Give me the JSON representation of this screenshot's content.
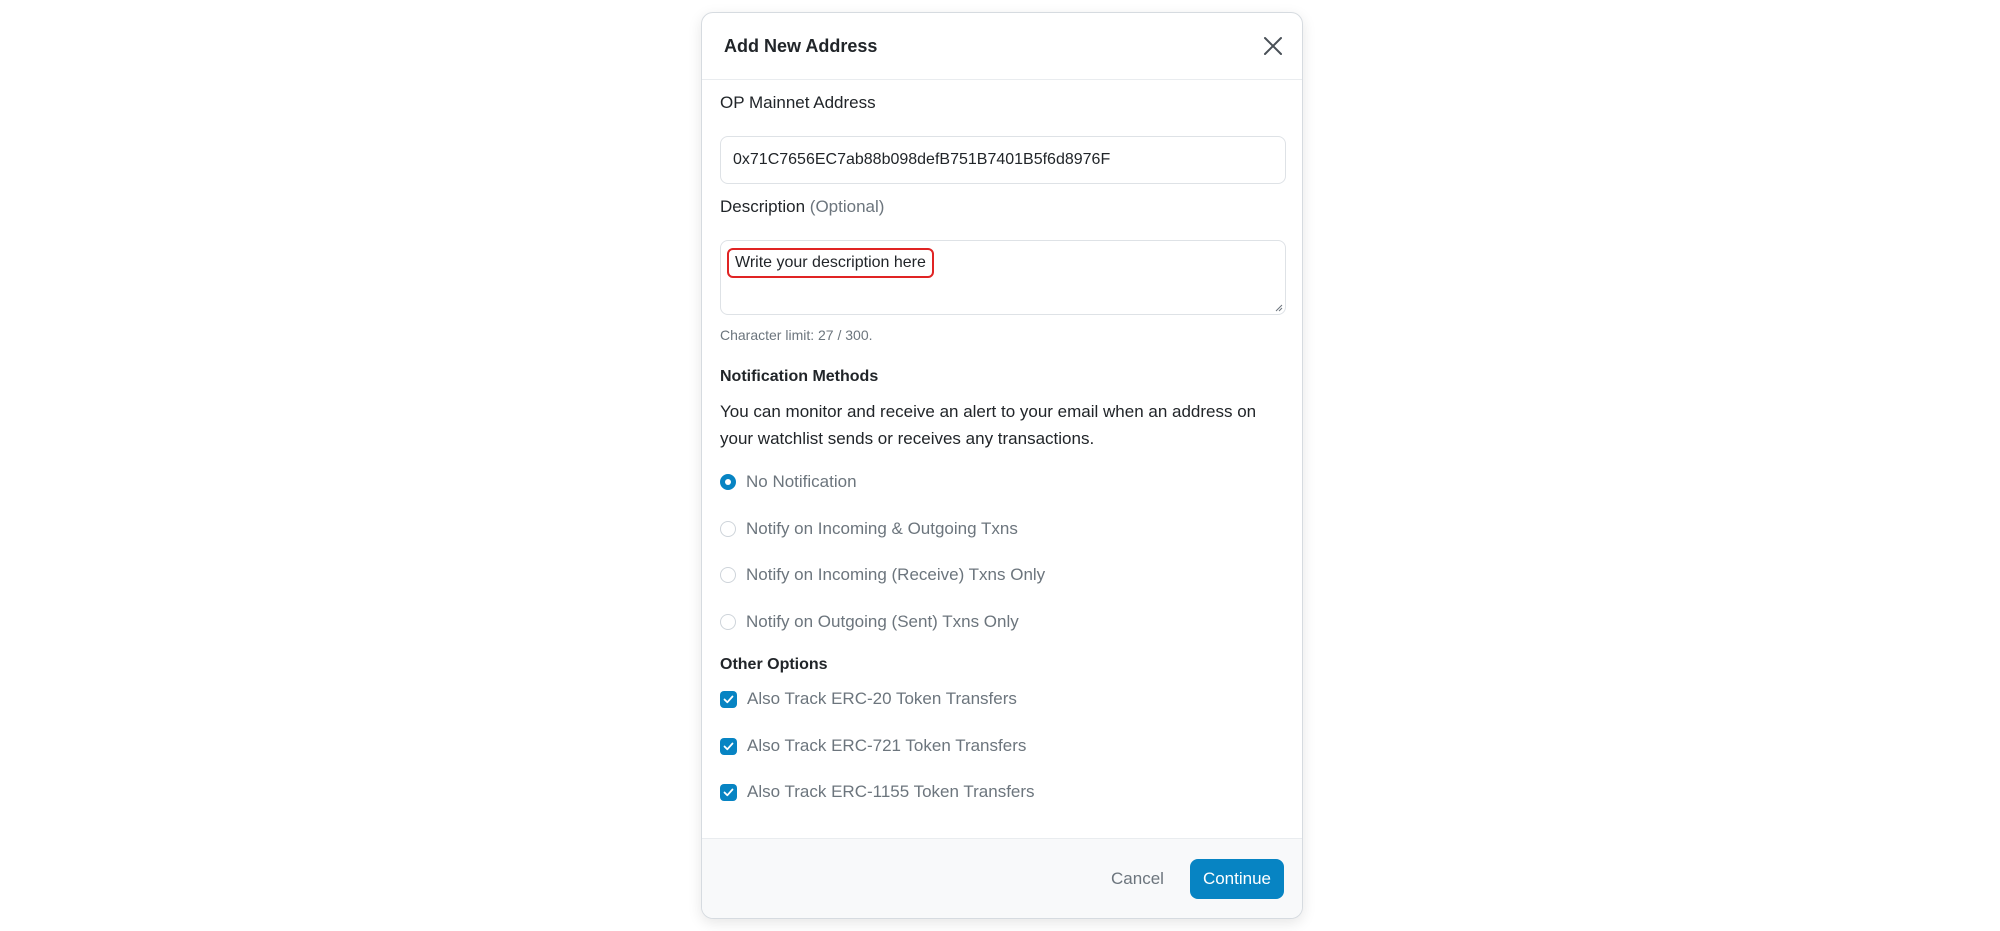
{
  "modal": {
    "title": "Add New Address"
  },
  "address_field": {
    "label": "OP Mainnet Address",
    "value": "0x71C7656EC7ab88b098defB751B7401B5f6d8976F"
  },
  "description_field": {
    "label": "Description",
    "optional_label": "(Optional)",
    "placeholder": "Write your description here",
    "char_limit_text": "Character limit: 27 / 300."
  },
  "notification": {
    "title": "Notification Methods",
    "description": "You can monitor and receive an alert to your email when an address on your watchlist sends or receives any transactions.",
    "options": [
      {
        "label": "No Notification",
        "selected": true
      },
      {
        "label": "Notify on Incoming & Outgoing Txns",
        "selected": false
      },
      {
        "label": "Notify on Incoming (Receive) Txns Only",
        "selected": false
      },
      {
        "label": "Notify on Outgoing (Sent) Txns Only",
        "selected": false
      }
    ]
  },
  "other_options": {
    "title": "Other Options",
    "options": [
      {
        "label": "Also Track ERC-20 Token Transfers",
        "checked": true
      },
      {
        "label": "Also Track ERC-721 Token Transfers",
        "checked": true
      },
      {
        "label": "Also Track ERC-1155 Token Transfers",
        "checked": true
      }
    ]
  },
  "footer": {
    "cancel_label": "Cancel",
    "continue_label": "Continue"
  },
  "colors": {
    "accent": "#0784c3",
    "highlight_border": "#e02424"
  },
  "icons": {
    "close": "close-icon",
    "check": "check-icon",
    "resize": "resize-grip-icon"
  }
}
